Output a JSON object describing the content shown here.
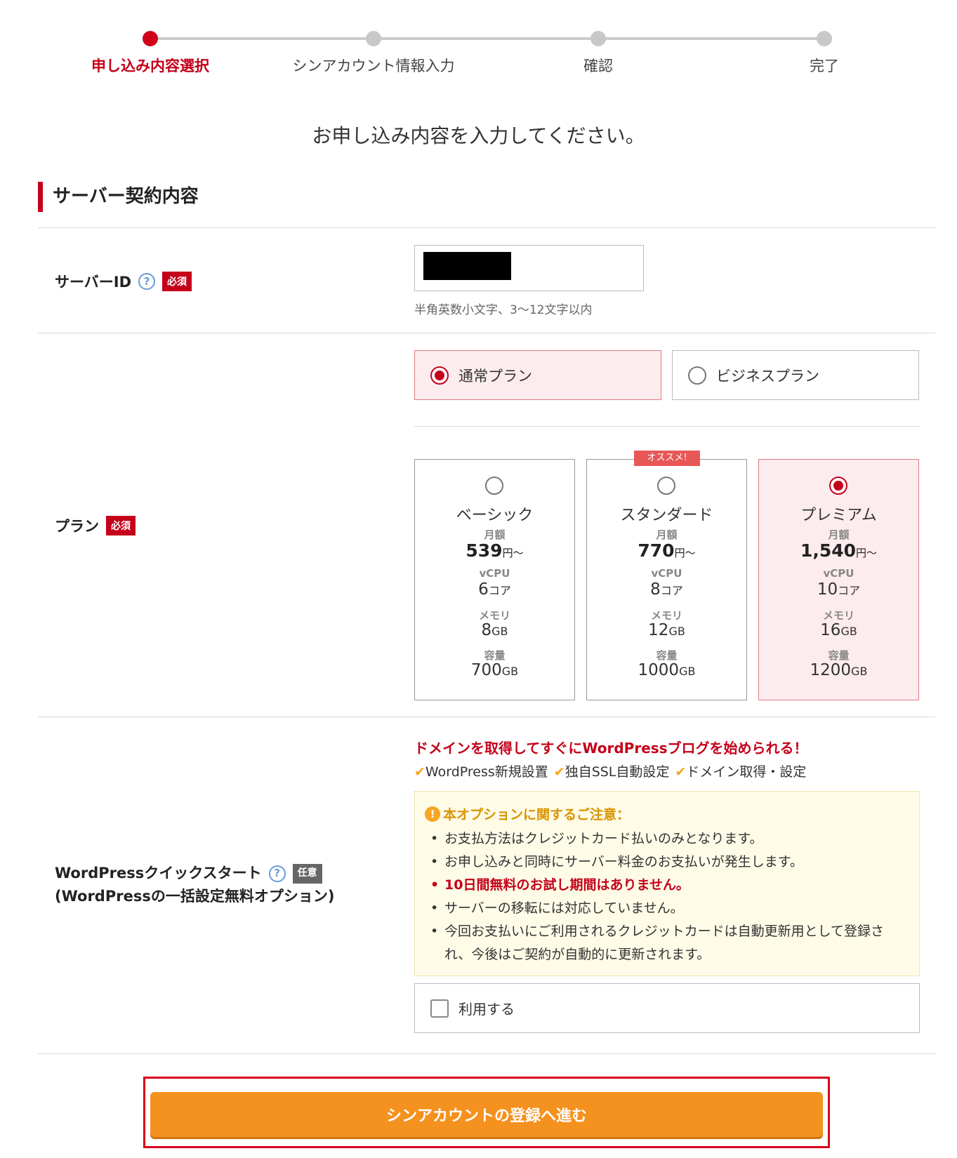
{
  "stepper": {
    "steps": [
      {
        "label": "申し込み内容選択",
        "active": true
      },
      {
        "label": "シンアカウント情報入力",
        "active": false
      },
      {
        "label": "確認",
        "active": false
      },
      {
        "label": "完了",
        "active": false
      }
    ]
  },
  "lead_text": "お申し込み内容を入力してください。",
  "section_title": "サーバー契約内容",
  "server_id": {
    "label": "サーバーID",
    "help_icon": "?",
    "required_badge": "必須",
    "value": "",
    "hint": "半角英数小文字、3〜12文字以内"
  },
  "plan_type": {
    "options": [
      {
        "label": "通常プラン",
        "selected": true
      },
      {
        "label": "ビジネスプラン",
        "selected": false
      }
    ]
  },
  "plan": {
    "label": "プラン",
    "required_badge": "必須",
    "recommend_badge": "オススメ!",
    "labels": {
      "price": "月額",
      "cpu": "vCPU",
      "memory": "メモリ",
      "storage": "容量"
    },
    "cards": [
      {
        "name": "ベーシック",
        "price": "539",
        "price_unit": "円〜",
        "cpu": "6",
        "cpu_unit": "コア",
        "memory": "8",
        "memory_unit": "GB",
        "storage": "700",
        "storage_unit": "GB",
        "selected": false
      },
      {
        "name": "スタンダード",
        "price": "770",
        "price_unit": "円〜",
        "cpu": "8",
        "cpu_unit": "コア",
        "memory": "12",
        "memory_unit": "GB",
        "storage": "1000",
        "storage_unit": "GB",
        "selected": false
      },
      {
        "name": "プレミアム",
        "price": "1,540",
        "price_unit": "円〜",
        "cpu": "10",
        "cpu_unit": "コア",
        "memory": "16",
        "memory_unit": "GB",
        "storage": "1200",
        "storage_unit": "GB",
        "selected": true
      }
    ]
  },
  "wordpress": {
    "label_line1": "WordPressクイックスタート",
    "label_line2": "(WordPressの一括設定無料オプション)",
    "help_icon": "?",
    "optional_badge": "任意",
    "catch": "ドメインを取得してすぐにWordPressブログを始められる！",
    "check_mark": "✔",
    "features": [
      "WordPress新規設置",
      "独自SSL自動設定",
      "ドメイン取得・設定"
    ],
    "notice_icon": "!",
    "notice_title": "本オプションに関するご注意：",
    "notice_items": [
      "お支払方法はクレジットカード払いのみとなります。",
      "お申し込みと同時にサーバー料金のお支払いが発生します。",
      "10日間無料のお試し期間はありません。",
      "サーバーの移転には対応していません。",
      "今回お支払いにご利用されるクレジットカードは自動更新用として登録され、今後はご契約が自動的に更新されます。"
    ],
    "use_label": "利用する",
    "use_checked": false
  },
  "cta": {
    "label": "シンアカウントの登録へ進む"
  },
  "colors": {
    "accent": "#c4001a",
    "cta": "#f5911e",
    "selected_bg": "#fdecee",
    "notice_bg": "#fefbe7"
  }
}
